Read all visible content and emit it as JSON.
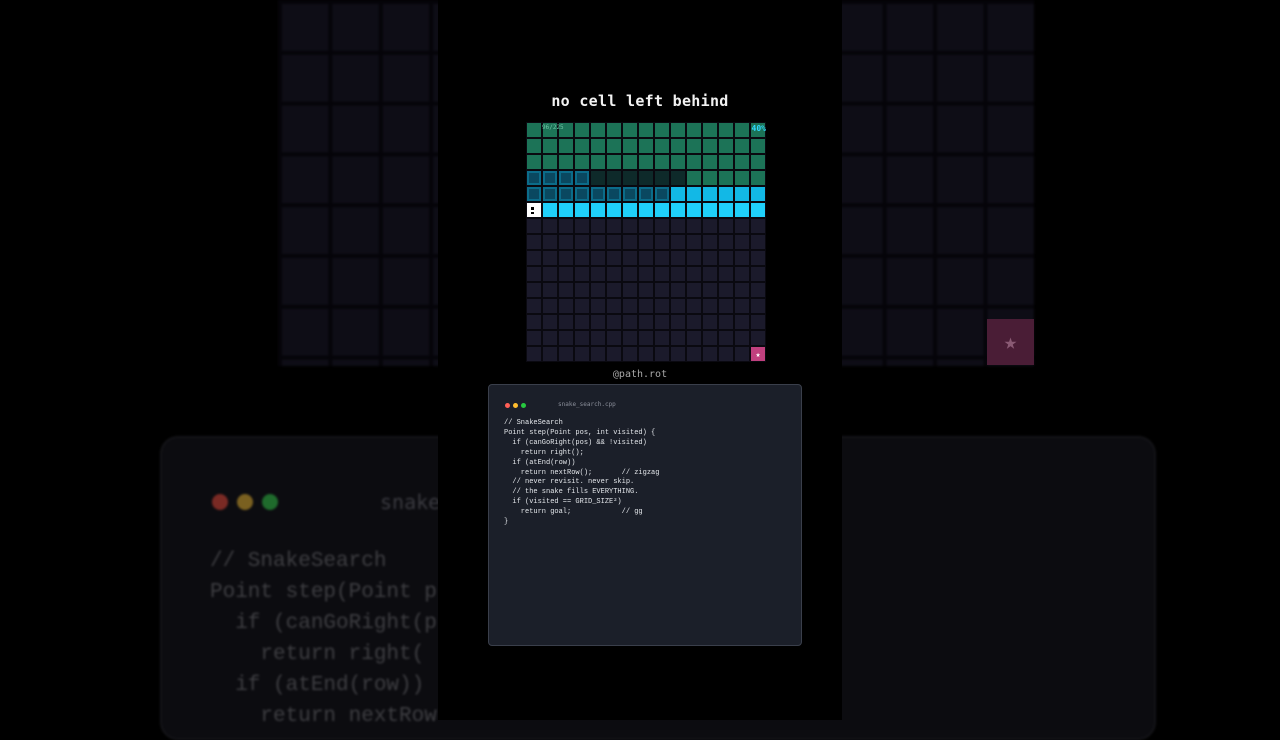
{
  "title": "no cell left behind",
  "grid": {
    "counter": "96/225",
    "percent": "40%",
    "goal_icon": "star"
  },
  "handle": "@path.rot",
  "code": {
    "filename": "snake_search.cpp",
    "lines": [
      "// SnakeSearch",
      "Point step(Point pos, int visited) {",
      "  if (canGoRight(pos) && !visited)",
      "    return right();",
      "  if (atEnd(row))",
      "    return nextRow();       // zigzag",
      "  // never revisit. never skip.",
      "  // the snake fills EVERYTHING.",
      "  if (visited == GRID_SIZE²)",
      "    return goal;            // gg",
      "}"
    ],
    "window_dots": [
      "#ff5f56",
      "#ffbd2e",
      "#27c93f"
    ]
  },
  "background": {
    "filename": "snake",
    "lines": [
      "// SnakeSearch",
      "Point step(Point p",
      "  if (canGoRight(p",
      "    return right(",
      "  if (atEnd(row))",
      "    return nextRow"
    ],
    "window_dots": [
      "#7a2a24",
      "#7a6020",
      "#1f6b2c"
    ]
  },
  "colors": {
    "visited_old": "#1c7357",
    "visited_recent": "#0f5a7a",
    "snake_body": "#1fd0fb",
    "snake_head": "#ffffff",
    "unvisited": "#1b1a2b",
    "goal": "#c0407e"
  }
}
